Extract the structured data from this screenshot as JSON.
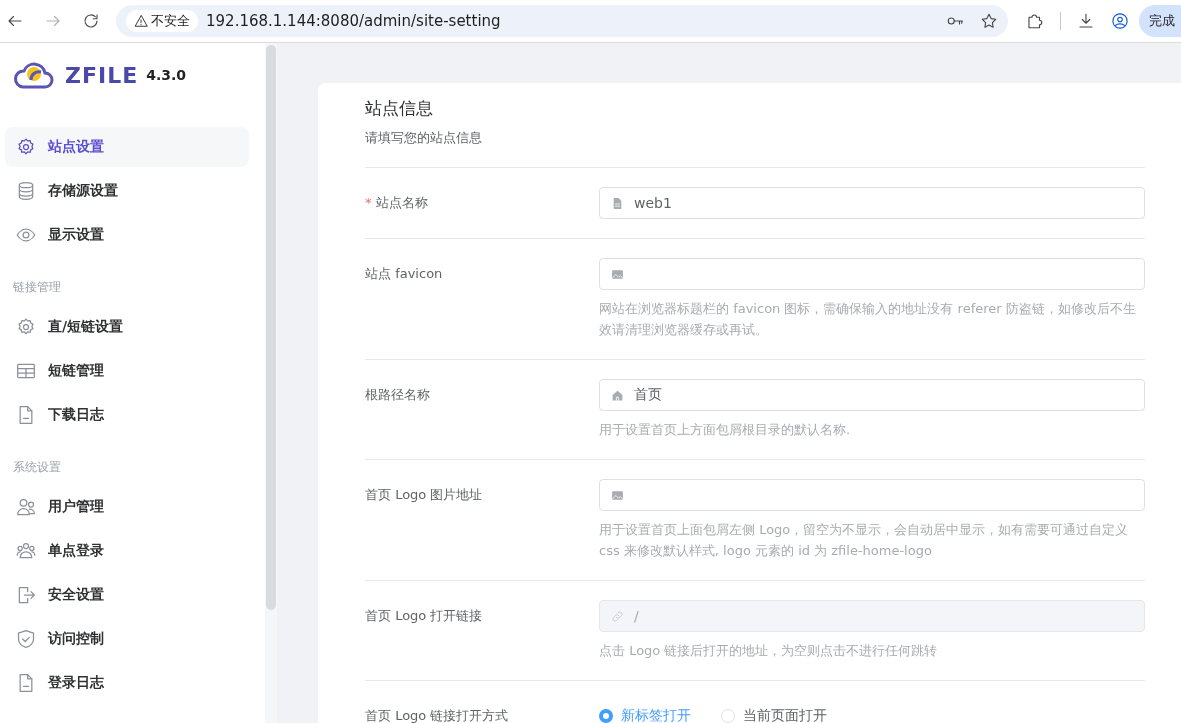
{
  "browser": {
    "security_label": "不安全",
    "url": "192.168.1.144:8080/admin/site-setting",
    "profile_button": "完成"
  },
  "sidebar": {
    "logo": {
      "name": "ZFILE",
      "version": "4.3.0"
    },
    "groups": [
      {
        "items": [
          {
            "label": "站点设置",
            "kind": "gear",
            "selected": true
          },
          {
            "label": "存储源设置",
            "kind": "database",
            "selected": false
          },
          {
            "label": "显示设置",
            "kind": "eye",
            "selected": false
          }
        ]
      },
      {
        "heading": "链接管理",
        "items": [
          {
            "label": "直/短链设置",
            "kind": "gear",
            "selected": false
          },
          {
            "label": "短链管理",
            "kind": "table",
            "selected": false
          },
          {
            "label": "下载日志",
            "kind": "file",
            "selected": false
          }
        ]
      },
      {
        "heading": "系统设置",
        "items": [
          {
            "label": "用户管理",
            "kind": "users",
            "selected": false
          },
          {
            "label": "单点登录",
            "kind": "group",
            "selected": false
          },
          {
            "label": "安全设置",
            "kind": "exit",
            "selected": false
          },
          {
            "label": "访问控制",
            "kind": "shield",
            "selected": false
          },
          {
            "label": "登录日志",
            "kind": "file",
            "selected": false
          }
        ]
      }
    ]
  },
  "form": {
    "title": "站点信息",
    "subtitle": "请填写您的站点信息",
    "rows": [
      {
        "kind": "input",
        "required_mark": "*",
        "label": "站点名称",
        "value": "web1",
        "disabled": false
      },
      {
        "kind": "input",
        "label": "站点 favicon",
        "disabled": false,
        "help": "网站在浏览器标题栏的 favicon 图标，需确保输入的地址没有 referer 防盗链，如修改后不生效请清理浏览器缓存或再试。"
      },
      {
        "kind": "input",
        "label": "根路径名称",
        "value": "首页",
        "disabled": false,
        "help": "用于设置首页上方面包屑根目录的默认名称."
      },
      {
        "kind": "input",
        "label": "首页 Logo 图片地址",
        "disabled": false,
        "help": "用于设置首页上面包屑左侧 Logo，留空为不显示，会自动居中显示，如有需要可通过自定义 css 来修改默认样式, logo 元素的 id 为 zfile-home-logo"
      },
      {
        "kind": "input",
        "label": "首页 Logo 打开链接",
        "value": "/",
        "disabled": true,
        "help": "点击 Logo 链接后打开的地址，为空则点击不进行任何跳转"
      },
      {
        "kind": "radio",
        "label": "首页 Logo 链接打开方式",
        "options": [
          {
            "label": "新标签打开",
            "selected": true
          },
          {
            "label": "当前页面打开",
            "selected": false
          }
        ]
      }
    ]
  }
}
